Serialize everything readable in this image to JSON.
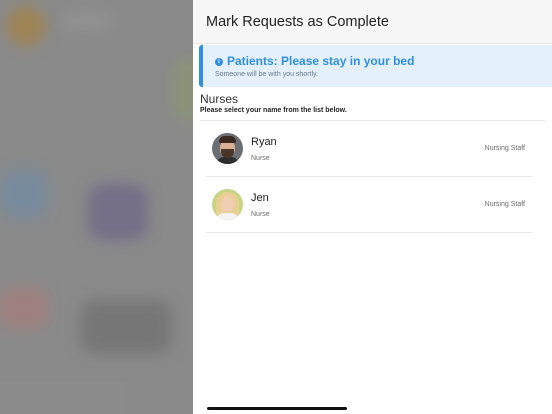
{
  "header": {
    "title": "Mark Requests as Complete"
  },
  "alert": {
    "icon": "info-icon",
    "title": "Patients: Please stay in your bed",
    "subtitle": "Someone will be with you shortly.",
    "accent_color": "#2f8fe3"
  },
  "section": {
    "title": "Nurses",
    "subtitle": "Please select your name from the list below."
  },
  "nurses": [
    {
      "name": "Ryan",
      "role": "Nurse",
      "group": "Nursing Staff"
    },
    {
      "name": "Jen",
      "role": "Nurse",
      "group": "Nursing Staff"
    }
  ]
}
